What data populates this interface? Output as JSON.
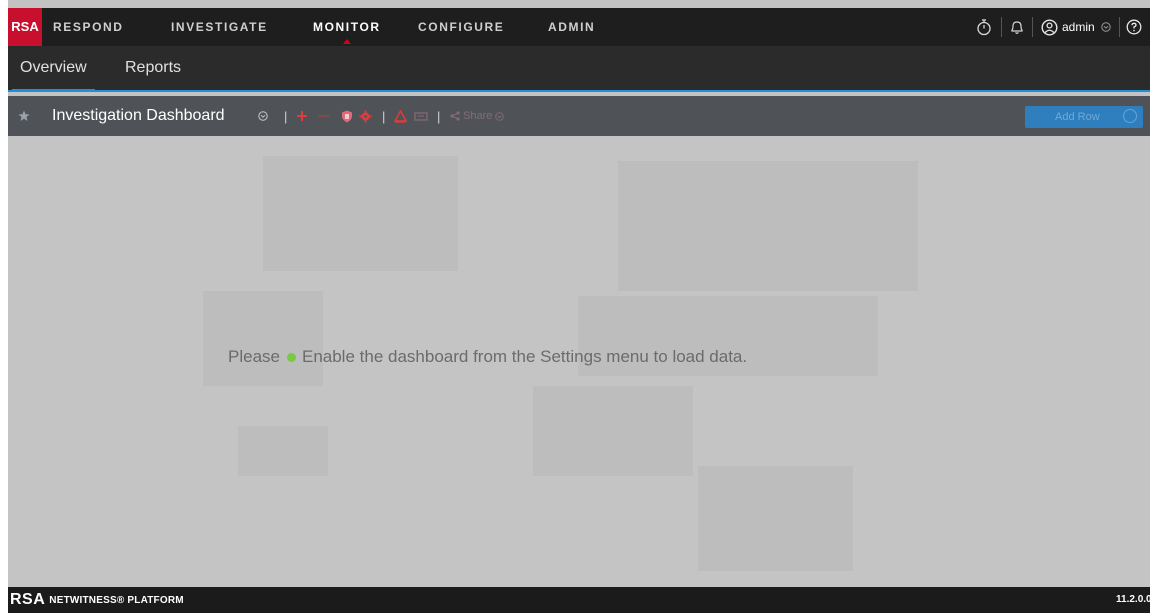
{
  "logo": {
    "text": "RSA"
  },
  "topnav": {
    "items": [
      {
        "label": "RESPOND"
      },
      {
        "label": "INVESTIGATE"
      },
      {
        "label": "MONITOR",
        "active": true
      },
      {
        "label": "CONFIGURE"
      },
      {
        "label": "ADMIN"
      }
    ],
    "right": {
      "icons": [
        "stopwatch-icon",
        "bell-icon",
        "user-icon",
        "help-icon"
      ],
      "user_label": "admin"
    }
  },
  "subnav": {
    "tabs": [
      {
        "label": "Overview",
        "active": true
      },
      {
        "label": "Reports"
      }
    ]
  },
  "toolbar": {
    "dashboard_title": "Investigation Dashboard",
    "share_label": "Share",
    "add_row_label": "Add Row",
    "icons": [
      "star-icon",
      "dropdown-icon",
      "add-icon",
      "remove-icon",
      "shield-icon",
      "settings-icon",
      "alert-icon",
      "print-icon",
      "share-icon"
    ]
  },
  "main": {
    "message_prefix": "Please",
    "message_text": "Enable the dashboard from the Settings menu to load data."
  },
  "footer": {
    "brand": "RSA",
    "product": "NETWITNESS® PLATFORM",
    "version": "11.2.0.0"
  },
  "colors": {
    "brand_red": "#c8102e",
    "accent_blue": "#1f8fd8",
    "status_green": "#7ac943",
    "toolbar_bg": "#4f5358"
  }
}
